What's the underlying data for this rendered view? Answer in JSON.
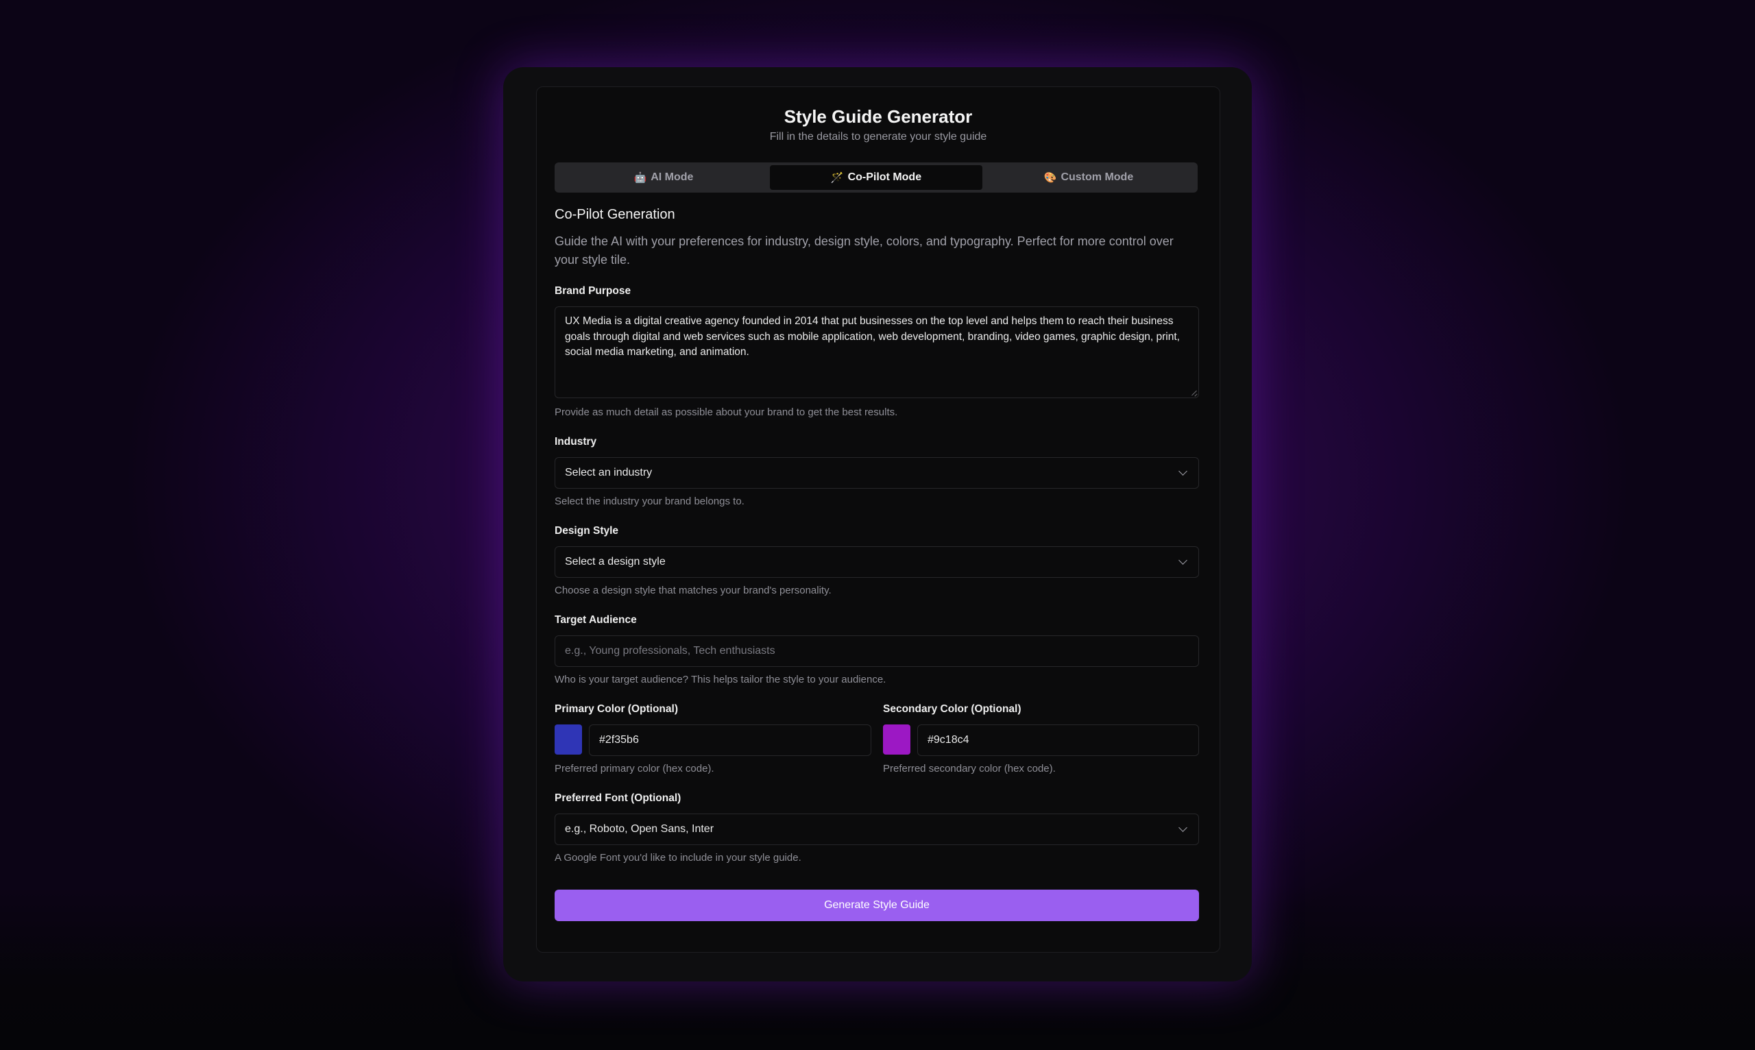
{
  "header": {
    "title": "Style Guide Generator",
    "subtitle": "Fill in the details to generate your style guide"
  },
  "tabs": [
    {
      "icon": "robot-icon",
      "glyph": "🤖",
      "label": "AI Mode",
      "active": false
    },
    {
      "icon": "magic-wand-icon",
      "glyph": "🪄",
      "label": "Co-Pilot Mode",
      "active": true
    },
    {
      "icon": "palette-icon",
      "glyph": "🎨",
      "label": "Custom Mode",
      "active": false
    }
  ],
  "section": {
    "title": "Co-Pilot Generation",
    "description": "Guide the AI with your preferences for industry, design style, colors, and typography. Perfect for more control over your style tile."
  },
  "brand_purpose": {
    "label": "Brand Purpose",
    "value": "UX Media is a digital creative agency founded in 2014 that put businesses on the top level and helps them to reach their business goals through digital and web services such as mobile application, web development, branding, video games, graphic design, print, social media marketing, and animation.",
    "help": "Provide as much detail as possible about your brand to get the best results."
  },
  "industry": {
    "label": "Industry",
    "value": "Select an industry",
    "help": "Select the industry your brand belongs to."
  },
  "design_style": {
    "label": "Design Style",
    "value": "Select a design style",
    "help": "Choose a design style that matches your brand's personality."
  },
  "target_audience": {
    "label": "Target Audience",
    "placeholder": "e.g., Young professionals, Tech enthusiasts",
    "help": "Who is your target audience? This helps tailor the style to your audience."
  },
  "primary_color": {
    "label": "Primary Color (Optional)",
    "value": "#2f35b6",
    "swatch": "#2f35b6",
    "help": "Preferred primary color (hex code)."
  },
  "secondary_color": {
    "label": "Secondary Color (Optional)",
    "value": "#9c18c4",
    "swatch": "#9c18c4",
    "help": "Preferred secondary color (hex code)."
  },
  "preferred_font": {
    "label": "Preferred Font (Optional)",
    "value": "e.g., Roboto, Open Sans, Inter",
    "help": "A Google Font you'd like to include in your style guide."
  },
  "generate_button": {
    "label": "Generate Style Guide",
    "color": "#9a5ff0"
  }
}
